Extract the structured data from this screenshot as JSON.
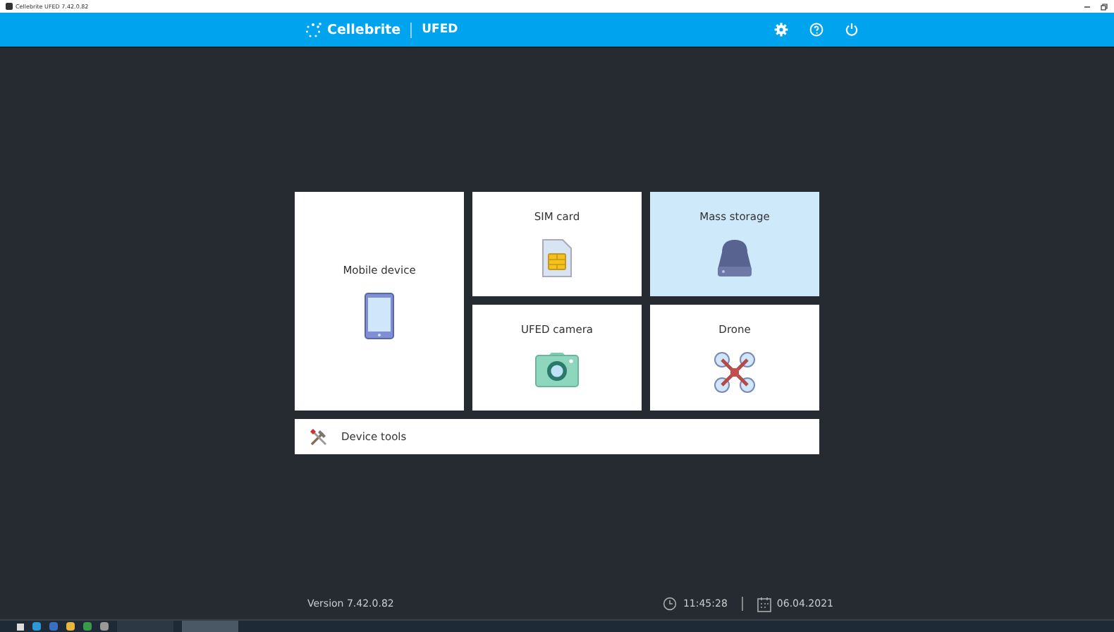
{
  "window": {
    "title": "Cellebrite UFED 7.42.0.82"
  },
  "header": {
    "brand": "Cellebrite",
    "product": "UFED"
  },
  "tiles": [
    {
      "label": "Mobile device",
      "kind": "phone",
      "selected": false
    },
    {
      "label": "SIM card",
      "kind": "sim",
      "selected": false
    },
    {
      "label": "Mass storage",
      "kind": "storage",
      "selected": true
    },
    {
      "label": "UFED camera",
      "kind": "camera",
      "selected": false
    },
    {
      "label": "Drone",
      "kind": "drone",
      "selected": false
    }
  ],
  "tools": {
    "label": "Device tools"
  },
  "footer": {
    "version": "Version 7.42.0.82",
    "time": "11:45:28",
    "date": "06.04.2021"
  }
}
